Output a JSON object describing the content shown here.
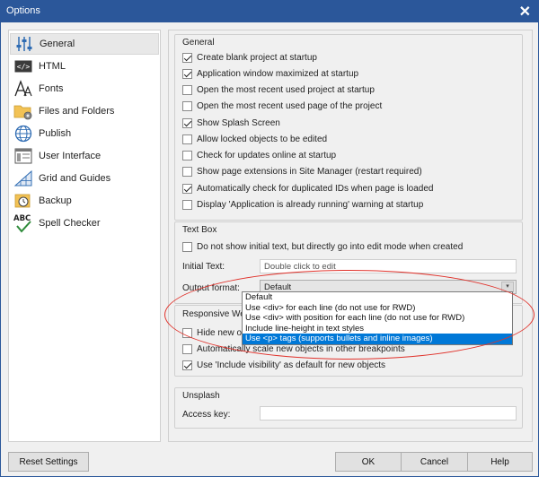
{
  "window": {
    "title": "Options",
    "close_glyph": "✕"
  },
  "sidebar": {
    "items": [
      {
        "label": "General",
        "icon": "sliders-icon"
      },
      {
        "label": "HTML",
        "icon": "html-tag-icon"
      },
      {
        "label": "Fonts",
        "icon": "font-icon"
      },
      {
        "label": "Files and Folders",
        "icon": "folder-gear-icon"
      },
      {
        "label": "Publish",
        "icon": "globe-icon"
      },
      {
        "label": "User Interface",
        "icon": "window-layout-icon"
      },
      {
        "label": "Grid and Guides",
        "icon": "grid-ruler-icon"
      },
      {
        "label": "Backup",
        "icon": "backup-clock-icon"
      },
      {
        "label": "Spell Checker",
        "icon": "abc-check-icon"
      }
    ]
  },
  "general": {
    "title": "General",
    "options": [
      {
        "label": "Create blank project at startup",
        "checked": true
      },
      {
        "label": "Application window maximized at startup",
        "checked": true
      },
      {
        "label": "Open the most recent used project at startup",
        "checked": false
      },
      {
        "label": "Open the most recent used page of the project",
        "checked": false
      },
      {
        "label": "Show Splash Screen",
        "checked": true
      },
      {
        "label": "Allow locked objects to be edited",
        "checked": false
      },
      {
        "label": "Check for updates online at startup",
        "checked": false
      },
      {
        "label": "Show page extensions in Site Manager (restart required)",
        "checked": false
      },
      {
        "label": "Automatically check for duplicated IDs when page is loaded",
        "checked": true
      },
      {
        "label": "Display 'Application is already running' warning at startup",
        "checked": false
      }
    ]
  },
  "textbox": {
    "title": "Text Box",
    "no_initial_text": {
      "label": "Do not show initial text, but directly go into edit mode when created",
      "checked": false
    },
    "initial_text_label": "Initial Text:",
    "initial_text_value": "Double click to edit",
    "output_format_label": "Output format:",
    "output_format_value": "Default",
    "output_format_options": [
      "Default",
      "Use <div> for each line (do not use for RWD)",
      "Use <div> with position for each line  (do not use for RWD)",
      "Include line-height in text styles",
      "Use <p> tags (supports bullets and inline images)"
    ],
    "selected_option_index": 4
  },
  "responsive": {
    "title_partial": "Responsive Web",
    "hide_new_label": "Hide new obj",
    "auto_scale": {
      "label": "Automatically scale new objects in other breakpoints",
      "checked": false
    },
    "include_visibility": {
      "label": "Use 'Include visibility' as default for new objects",
      "checked": true
    }
  },
  "unsplash": {
    "title": "Unsplash",
    "access_key_label": "Access key:",
    "access_key_value": ""
  },
  "buttons": {
    "reset": "Reset Settings",
    "ok": "OK",
    "cancel": "Cancel",
    "help": "Help"
  },
  "colors": {
    "titlebar": "#2b579a",
    "highlight": "#0078d7",
    "annotation": "#e0322b"
  }
}
